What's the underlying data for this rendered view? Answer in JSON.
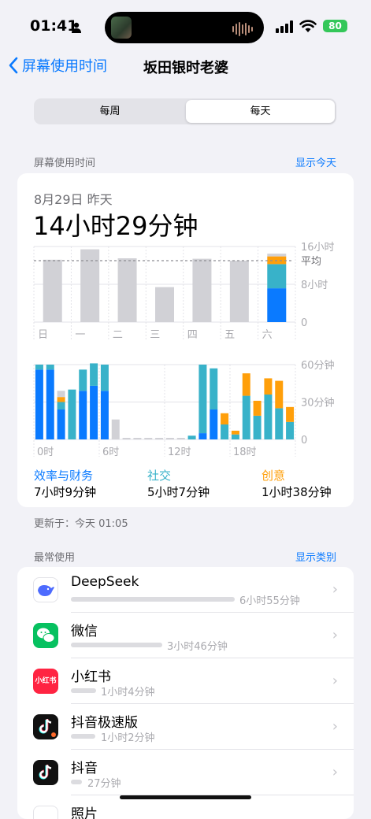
{
  "status": {
    "time": "01:41",
    "battery": "80"
  },
  "nav": {
    "back_label": "屏幕使用时间",
    "title": "坂田银时老婆"
  },
  "segment": {
    "options": [
      "每周",
      "每天"
    ],
    "selected": "每天"
  },
  "summary_section": {
    "header": "屏幕使用时间",
    "link": "显示今天"
  },
  "summary": {
    "date": "8月29日 昨天",
    "total": "14小时29分钟",
    "updated": "更新于：今天 01:05"
  },
  "colors": {
    "productivity": "#0a7aff",
    "social": "#38b2c9",
    "creativity": "#ff9f0a",
    "other": "#d1d1d6",
    "accent": "#0a7aff"
  },
  "chart_data": [
    {
      "type": "bar",
      "title": "",
      "categories": [
        "日",
        "一",
        "二",
        "三",
        "四",
        "五",
        "六"
      ],
      "values": [
        13.2,
        15.4,
        13.5,
        7.4,
        13.4,
        13.0,
        14.48
      ],
      "avg_label": "平均",
      "avg_value": 13.0,
      "y_tick_labels": [
        "16小时",
        "8小时",
        "0"
      ],
      "ylim": [
        0,
        16
      ],
      "highlight_breakdown": {
        "productivity": 7.15,
        "social": 5.12,
        "creativity": 1.63,
        "other": 0.58
      }
    },
    {
      "type": "bar",
      "stacked": true,
      "x_tick_labels": [
        "0时",
        "6时",
        "12时",
        "18时"
      ],
      "y_tick_labels": [
        "60分钟",
        "30分钟",
        "0"
      ],
      "ylim": [
        0,
        60
      ],
      "hours": [
        0,
        1,
        2,
        3,
        4,
        5,
        6,
        7,
        8,
        9,
        10,
        11,
        12,
        13,
        14,
        15,
        16,
        17,
        18,
        19,
        20,
        21,
        22,
        23
      ],
      "series": [
        {
          "name": "效率与财务",
          "values": [
            56,
            56,
            24,
            0,
            39,
            43,
            39,
            0,
            0,
            0,
            0,
            0,
            0,
            0,
            0,
            5,
            24,
            0,
            0,
            0,
            0,
            0,
            0,
            0
          ]
        },
        {
          "name": "社交",
          "values": [
            4,
            4,
            6,
            40,
            17,
            18,
            21,
            0,
            0,
            0,
            0,
            0,
            0,
            0,
            3,
            55,
            33,
            12,
            4,
            35,
            19,
            36,
            25,
            14
          ]
        },
        {
          "name": "创意",
          "values": [
            0,
            0,
            4,
            0,
            0,
            0,
            0,
            0,
            0,
            0,
            0,
            0,
            0,
            0,
            0,
            0,
            0,
            9,
            3,
            18,
            12,
            13,
            22,
            12
          ]
        },
        {
          "name": "其他",
          "values": [
            0,
            0,
            5,
            0,
            0,
            0,
            0,
            16,
            0,
            0,
            0,
            0,
            0,
            0,
            0,
            0,
            0,
            0,
            0,
            0,
            0,
            0,
            0,
            0
          ]
        }
      ]
    }
  ],
  "categories_summary": [
    {
      "name": "效率与财务",
      "value": "7小时9分钟"
    },
    {
      "name": "社交",
      "value": "5小时7分钟"
    },
    {
      "name": "创意",
      "value": "1小时38分钟"
    }
  ],
  "most_used": {
    "header": "最常使用",
    "link": "显示类别",
    "apps": [
      {
        "name": "DeepSeek",
        "time": "6小时55分钟",
        "minutes": 415,
        "icon": "deepseek-icon"
      },
      {
        "name": "微信",
        "time": "3小时46分钟",
        "minutes": 226,
        "icon": "wechat-icon"
      },
      {
        "name": "小红书",
        "time": "1小时4分钟",
        "minutes": 64,
        "icon": "xiaohongshu-icon",
        "icon_text": "小红书"
      },
      {
        "name": "抖音极速版",
        "time": "1小时2分钟",
        "minutes": 62,
        "icon": "douyin-lite-icon"
      },
      {
        "name": "抖音",
        "time": "27分钟",
        "minutes": 27,
        "icon": "douyin-icon"
      },
      {
        "name": "照片",
        "time": "",
        "minutes": 0,
        "icon": "photos-icon"
      }
    ]
  }
}
